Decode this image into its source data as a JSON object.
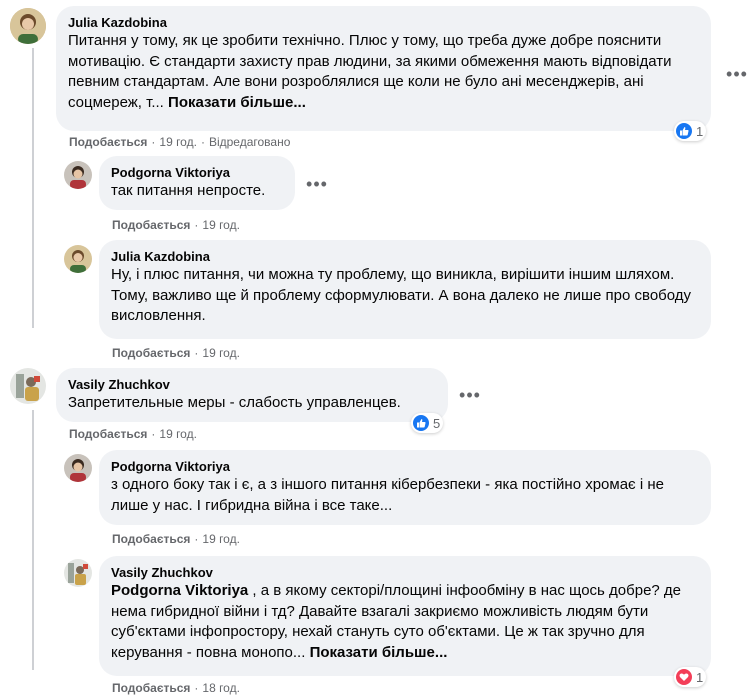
{
  "comments": [
    {
      "author": "Julia Kazdobina",
      "text": "Питання у тому, як це зробити технічно. Плюс у тому, що треба дуже добре пояснити мотивацію. Є стандарти захисту прав людини, за якими обмеження мають відповідати певним стандартам. Але вони розроблялися ще коли не було ані месенджерів, ані соцмереж, т... ",
      "see_more": "Показати більше...",
      "like": "Подобається",
      "time": "19 год.",
      "edited": "Відредаговано",
      "reactions": {
        "icon": "like-icon",
        "count": "1"
      }
    },
    {
      "author": "Podgorna Viktoriya",
      "text": "так питання непросте.",
      "like": "Подобається",
      "time": "19 год."
    },
    {
      "author": "Julia Kazdobina",
      "text": "Ну, і плюс питання, чи можна ту проблему, що виникла, вирішити іншим шляхом. Тому, важливо ще й проблему сформулювати. А вона далеко не лише про свободу висловлення.",
      "like": "Подобається",
      "time": "19 год."
    },
    {
      "author": "Vasily Zhuchkov",
      "text": "Запретительные меры - слабость управленцев.",
      "like": "Подобається",
      "time": "19 год.",
      "reactions": {
        "icon": "like-icon",
        "count": "5"
      }
    },
    {
      "author": "Podgorna Viktoriya",
      "text": "з одного боку так і є, а з іншого питання кібербезпеки - яка постійно хромає і не лише у нас. І гибридна війна і все таке...",
      "like": "Подобається",
      "time": "19 год."
    },
    {
      "author": "Vasily Zhuchkov",
      "mention": "Podgorna Viktoriya",
      "text": " , а в якому секторі/площині інфообміну в нас щось добре? де нема гибридної війни і тд? Давайте взагалі закриємо можливість людям бути суб'єктами інфопростору, нехай стануть суто об'єктами. Це ж так зручно для керування - повна монопо... ",
      "see_more": "Показати більше...",
      "like": "Подобається",
      "time": "18 год.",
      "reactions": {
        "icon": "love-icon",
        "count": "1"
      }
    }
  ],
  "more_glyph": "•••",
  "separator": "·",
  "colors": {
    "bubble": "#f0f2f5",
    "meta": "#65676b",
    "like_blue": "#1877f2",
    "love_red": "#f33e58"
  }
}
